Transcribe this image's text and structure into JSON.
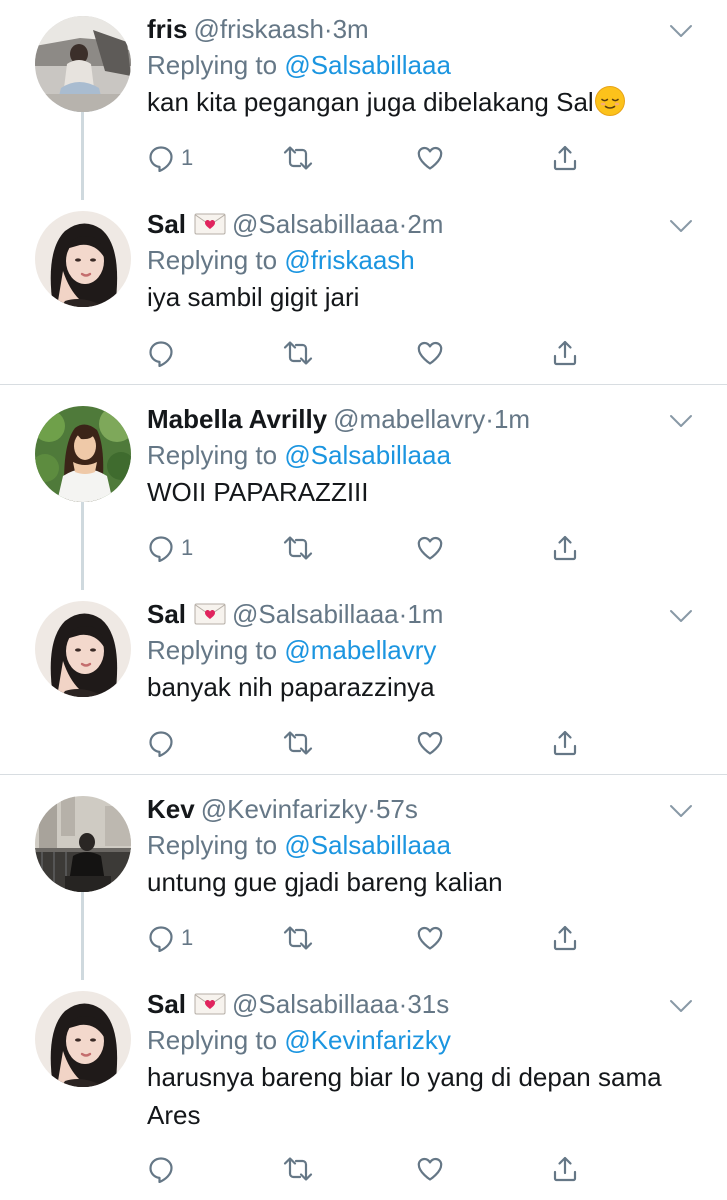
{
  "labels": {
    "replying_to": "Replying to",
    "dot": "·"
  },
  "threads": [
    {
      "tweets": [
        {
          "name": "fris",
          "handle": "@friskaash",
          "time": "3m",
          "reply_to": "@Salsabillaaa",
          "text": "kan kita pegangan juga dibelakang Sal",
          "emoji": "relieved-face-emoji",
          "reply_count": "1"
        },
        {
          "name": "Sal",
          "badge": "love-letter-emoji",
          "handle": "@Salsabillaaa",
          "time": "2m",
          "reply_to": "@friskaash",
          "text": "iya sambil gigit jari",
          "reply_count": ""
        }
      ]
    },
    {
      "tweets": [
        {
          "name": "Mabella Avrilly",
          "handle": "@mabellavry",
          "time": "1m",
          "reply_to": "@Salsabillaaa",
          "text": "WOII PAPARAZZIII",
          "reply_count": "1"
        },
        {
          "name": "Sal",
          "badge": "love-letter-emoji",
          "handle": "@Salsabillaaa",
          "time": "1m",
          "reply_to": "@mabellavry",
          "text": "banyak nih paparazzinya",
          "reply_count": ""
        }
      ]
    },
    {
      "tweets": [
        {
          "name": "Kev",
          "handle": "@Kevinfarizky",
          "time": "57s",
          "reply_to": "@Salsabillaaa",
          "text": "untung gue gjadi bareng kalian",
          "reply_count": "1"
        },
        {
          "name": "Sal",
          "badge": "love-letter-emoji",
          "handle": "@Salsabillaaa",
          "time": "31s",
          "reply_to": "@Kevinfarizky",
          "text": "harusnya bareng biar lo yang di depan sama Ares",
          "reply_count": ""
        }
      ]
    }
  ],
  "icons": {
    "reply": "reply-icon",
    "retweet": "retweet-icon",
    "like": "heart-icon",
    "share": "share-icon",
    "more": "chevron-down-icon"
  },
  "colors": {
    "text": "#14171a",
    "secondary": "#657786",
    "link": "#1b95e0",
    "thread_line": "#cfd9de",
    "divider": "#d8dde1"
  }
}
